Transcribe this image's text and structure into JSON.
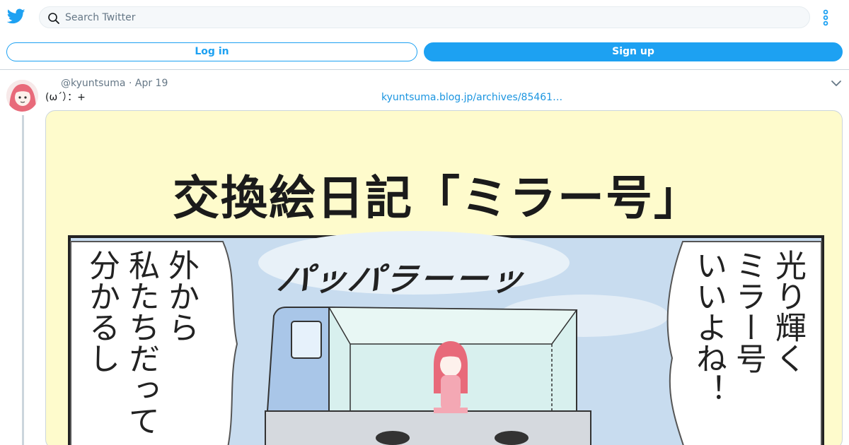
{
  "header": {
    "logo_icon": "twitter-bird-icon",
    "search": {
      "placeholder": "Search Twitter",
      "value": "",
      "icon": "search-icon"
    },
    "menu_icon": "more-vertical-icon"
  },
  "auth": {
    "login_label": "Log in",
    "signup_label": "Sign up"
  },
  "tweet": {
    "handle": "@kyuntsuma",
    "date": "· Apr 19",
    "text": "(ω´）：+",
    "link_text": "kyuntsuma.blog.jp/archives/85461…",
    "caret_icon": "chevron-down-icon",
    "media": {
      "title": "交換絵日記「ミラー号」",
      "sfx": "パッパラーーッ",
      "bubble_left": [
        "外から",
        "私たちだって",
        "分かるし"
      ],
      "bubble_right": [
        "光り輝く",
        "ミラー号",
        "いいよね！"
      ]
    }
  },
  "colors": {
    "accent": "#1da1f2",
    "link": "#1b95e0",
    "muted": "#657786",
    "border": "#ccd6dd",
    "media_bg": "#fefbcc"
  }
}
